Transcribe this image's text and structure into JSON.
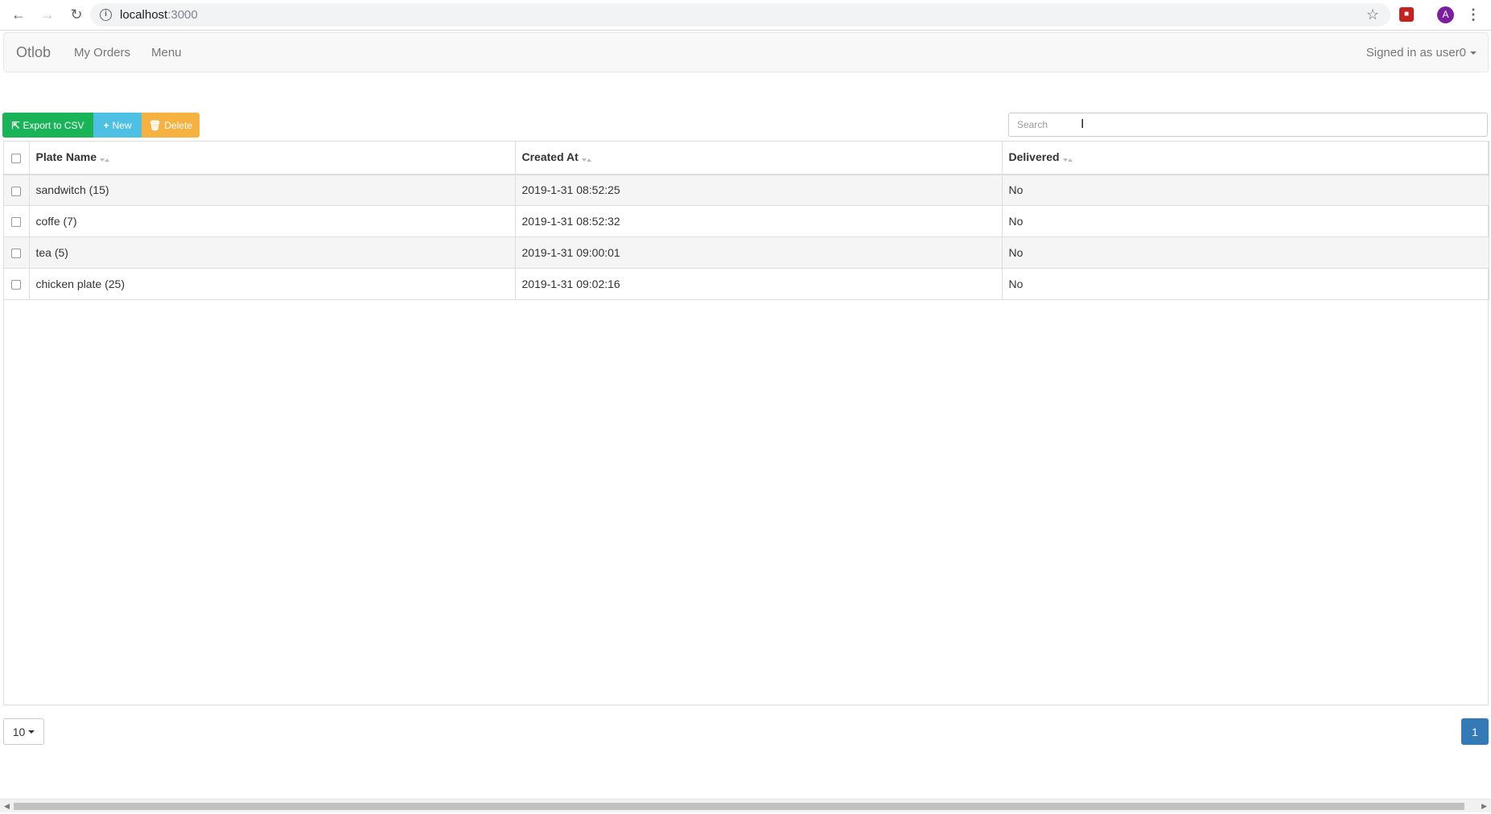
{
  "browser": {
    "url_host": "localhost",
    "url_port": ":3000",
    "avatar_letter": "A",
    "icons": [
      "back-icon",
      "forward-icon",
      "reload-icon",
      "info-icon",
      "star-icon",
      "extension-icon",
      "kebab-menu-icon"
    ]
  },
  "navbar": {
    "brand": "Otlob",
    "links": [
      "My Orders",
      "Menu"
    ],
    "user": "Signed in as user0"
  },
  "toolbar": {
    "export_label": "Export to CSV",
    "new_label": "New",
    "delete_label": "Delete",
    "search_placeholder": "Search",
    "colors": {
      "export": "#1ab458",
      "new": "#4dc0e3",
      "delete": "#f5b240"
    }
  },
  "table": {
    "columns": [
      "Plate Name",
      "Created At",
      "Delivered"
    ],
    "rows": [
      [
        "sandwitch (15)",
        "2019-1-31 08:52:25",
        "No"
      ],
      [
        "coffe (7)",
        "2019-1-31 08:52:32",
        "No"
      ],
      [
        "tea (5)",
        "2019-1-31 09:00:01",
        "No"
      ],
      [
        "chicken plate (25)",
        "2019-1-31 09:02:16",
        "No"
      ]
    ]
  },
  "pagination": {
    "page_size": "10",
    "current_page": "1",
    "accent": "#337ab7"
  }
}
